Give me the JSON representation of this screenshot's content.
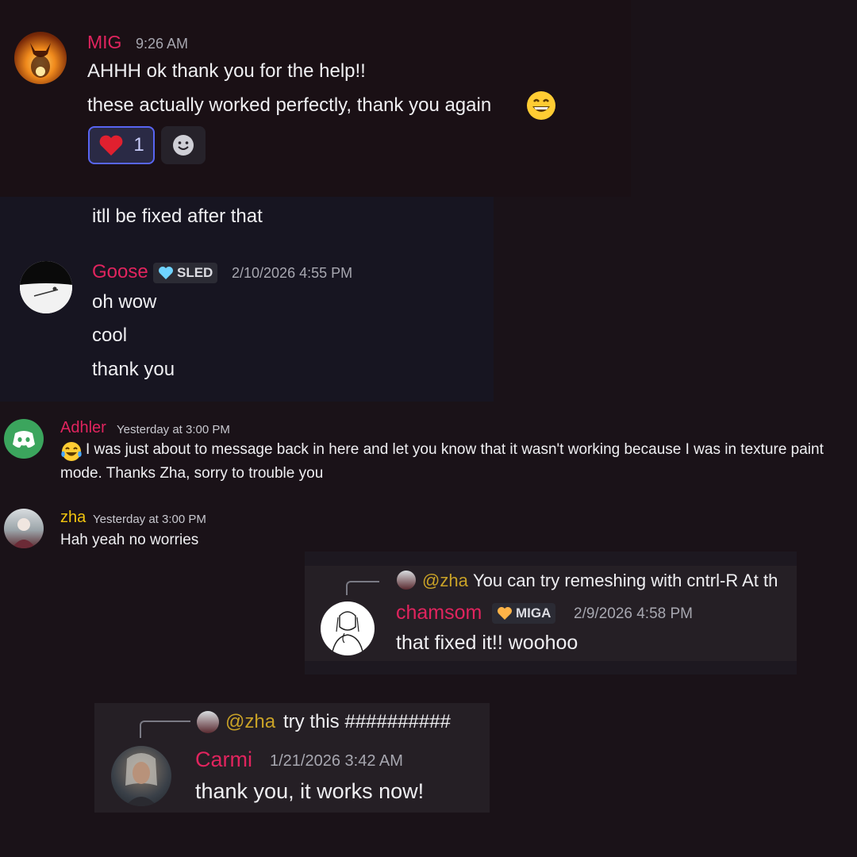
{
  "colors": {
    "background": "#1a1218",
    "username_pink": "#e0245e",
    "username_gold": "#f1c40f",
    "mention_gold": "#c9a227",
    "discord_green": "#3ba55d",
    "reaction_border": "#5865f2"
  },
  "block1": {
    "username": "MIG",
    "time": "9:26 AM",
    "line1": "AHHH ok thank you for the help!!",
    "line2": "these actually worked perfectly, thank you again",
    "emoji": "grinning-face-icon",
    "reaction_count": "1"
  },
  "block2": {
    "line_top": "itll be fixed after that",
    "username": "Goose",
    "badge": "SLED",
    "time": "2/10/2026 4:55 PM",
    "lines": [
      "oh wow",
      "cool",
      "thank you"
    ]
  },
  "block3": {
    "username": "Adhler",
    "time": "Yesterday at 3:00 PM",
    "line1": "I was just about to message back in here and let you know that it wasn't working because I was in texture paint",
    "line2": "mode. Thanks Zha, sorry to trouble you"
  },
  "block4": {
    "username": "zha",
    "time": "Yesterday at 3:00 PM",
    "message": "Hah yeah no worries"
  },
  "block5": {
    "reply_mention": "@zha",
    "reply_text": "You can try remeshing with cntrl-R  At th",
    "username": "chamsom",
    "badge": "MIGA",
    "time": "2/9/2026 4:58 PM",
    "message": "that fixed it!! woohoo"
  },
  "block6": {
    "reply_mention": "@zha",
    "reply_text": "try this ##########",
    "username": "Carmi",
    "time": "1/21/2026 3:42 AM",
    "message": "thank you, it works now!"
  }
}
